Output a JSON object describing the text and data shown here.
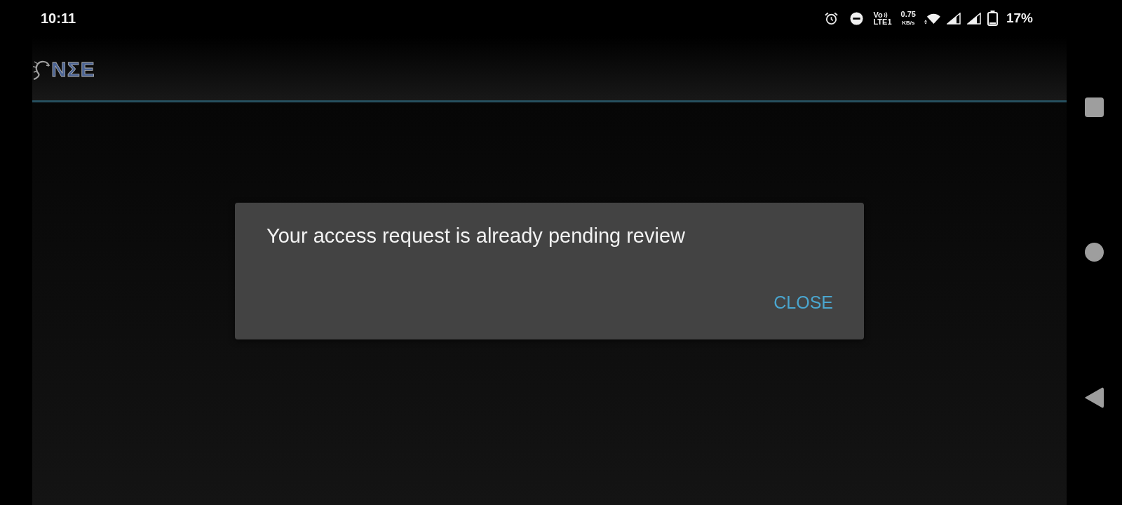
{
  "status_bar": {
    "time": "10:11",
    "volte": {
      "top": "Vo",
      "bottom": "LTE1"
    },
    "net_speed": {
      "value": "0.75",
      "unit": "KB/s"
    },
    "battery": "17%"
  },
  "app_bar": {
    "logo_text": "NΣE"
  },
  "dialog": {
    "message": "Your access request is already pending review",
    "buttons": [
      "CLOSE"
    ]
  }
}
